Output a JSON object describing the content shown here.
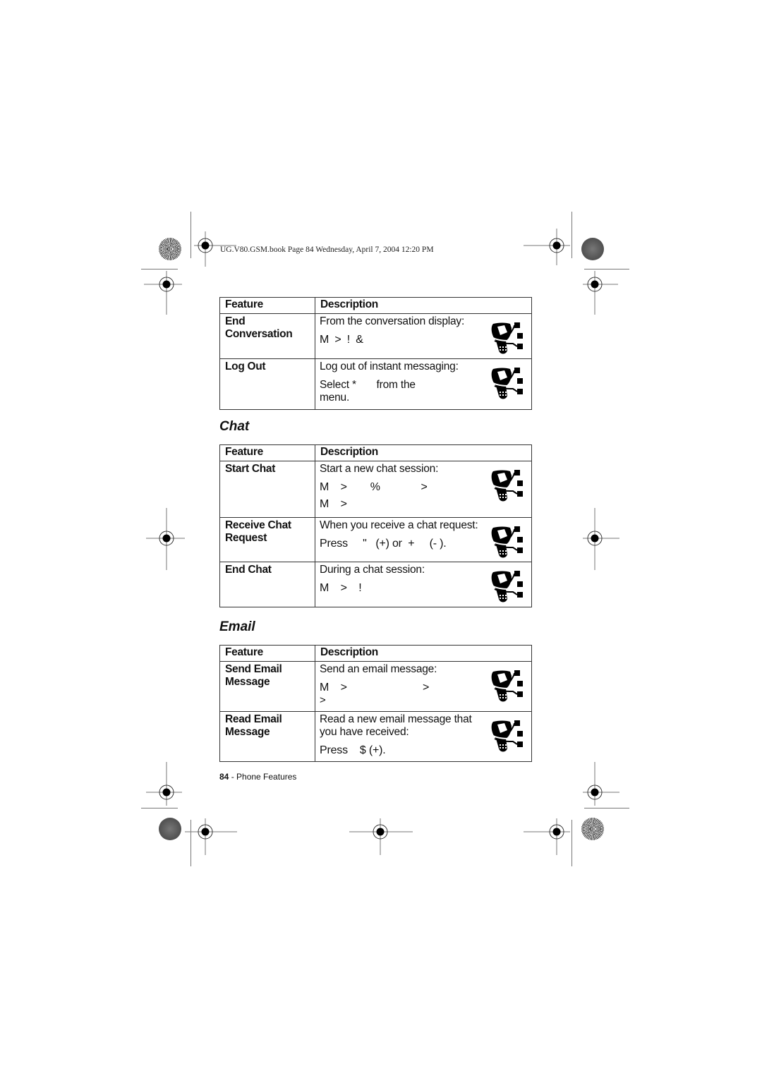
{
  "print_header": "UG.V80.GSM.book  Page 84  Wednesday, April 7, 2004  12:20 PM",
  "table_headers": {
    "feature": "Feature",
    "description": "Description"
  },
  "im_table": {
    "rows": [
      {
        "feature_line1": "End",
        "feature_line2": "Conversation",
        "desc_line1": "From the conversation display:",
        "desc_keys": "M  >  !   &"
      },
      {
        "feature_line1": "Log Out",
        "desc_line1": "Log out of instant messaging:",
        "desc_line2": "Select *       from the",
        "desc_line3": "menu."
      }
    ]
  },
  "chat_section": {
    "title": "Chat",
    "rows": [
      {
        "feature_line1": "Start Chat",
        "desc_line1": "Start a new chat session:",
        "desc_keys": "M  >    %       >",
        "desc_keys2": "M  >"
      },
      {
        "feature_line1": "Receive Chat",
        "feature_line2": "Request",
        "desc_line1": "When you receive a chat request:",
        "desc_keys": "Press     \"   (+) or  +     (- )."
      },
      {
        "feature_line1": "End Chat",
        "desc_line1": "During a chat session:",
        "desc_keys": "M  >  !"
      }
    ]
  },
  "email_section": {
    "title": "Email",
    "rows": [
      {
        "feature_line1": "Send Email",
        "feature_line2": "Message",
        "desc_line1": "Send an email message:",
        "desc_keys": "M  >             >",
        "desc_keys2": ">"
      },
      {
        "feature_line1": "Read Email",
        "feature_line2": "Message",
        "desc_line1": "Read a new email message that",
        "desc_line2": "you have received:",
        "desc_keys": "Press    $ (+)."
      }
    ]
  },
  "footer": {
    "page_number": "84",
    "section": " - Phone Features"
  },
  "icons": {
    "network_feature": "phone-network-icon"
  }
}
